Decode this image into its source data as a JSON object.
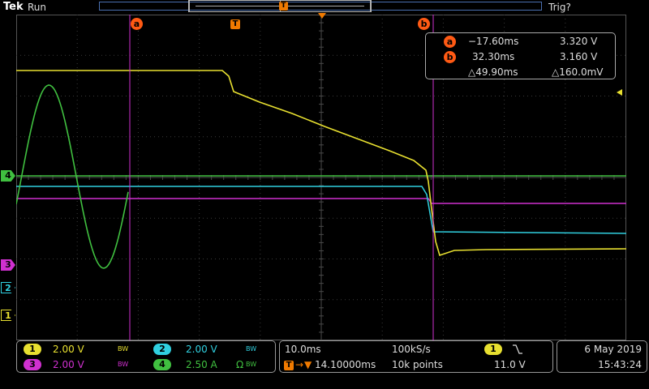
{
  "topbar": {
    "brand": "Tek",
    "run_state": "Run",
    "trigger_state": "Trig?",
    "trigger_marker": "T"
  },
  "cursors": {
    "a_label": "a",
    "b_label": "b",
    "trigger_marker": "T"
  },
  "readout": {
    "a_label": "a",
    "a_time": "−17.60ms",
    "a_value": "3.320 V",
    "b_label": "b",
    "b_time": "32.30ms",
    "b_value": "3.160 V",
    "delta_time": "△49.90ms",
    "delta_value": "△160.0mV"
  },
  "channel_markers": {
    "ch1": "1",
    "ch2": "2",
    "ch3": "3",
    "ch4": "4"
  },
  "bottom": {
    "ch1": {
      "num": "1",
      "scale": "2.00 V",
      "bw": "BW"
    },
    "ch2": {
      "num": "2",
      "scale": "2.00 V",
      "bw": "BW"
    },
    "ch3": {
      "num": "3",
      "scale": "2.00 V",
      "bw": "BW"
    },
    "ch4": {
      "num": "4",
      "scale": "2.50 A",
      "omega": "Ω",
      "bw": "BW"
    },
    "timebase": "10.0ms",
    "sample_rate": "100kS/s",
    "trigger_pos_prefix": "T",
    "trigger_position": "14.10000ms",
    "record_length": "10k points",
    "trigger_source": "1",
    "trigger_slope_icon": "falling-edge-icon",
    "trigger_level": "11.0 V",
    "date": "6 May 2019",
    "time": "15:43:24"
  },
  "colors": {
    "ch1": "#e8e030",
    "ch2": "#30d0e0",
    "ch3": "#d030d0",
    "ch4": "#40c040",
    "cursor": "#ff5a14",
    "trigger": "#f07a00",
    "grid": "#3a3a3a"
  }
}
